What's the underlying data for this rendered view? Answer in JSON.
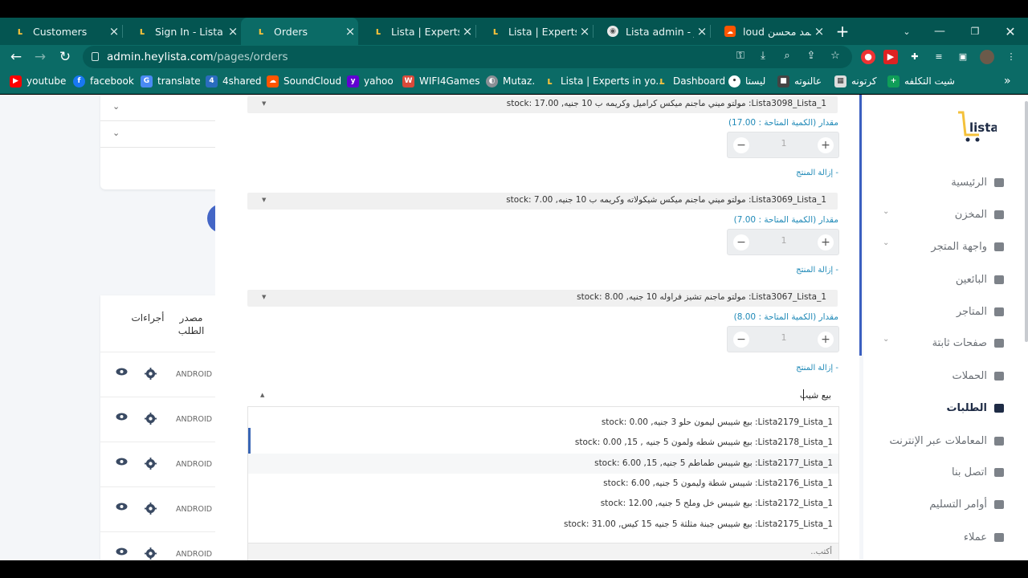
{
  "browser": {
    "tabs": [
      {
        "title": "Customers",
        "icon": "lista-favicon"
      },
      {
        "title": "Sign In - Lista",
        "icon": "lista-favicon"
      },
      {
        "title": "Orders",
        "icon": "lista-favicon",
        "active": true
      },
      {
        "title": "Lista | Experts in y",
        "icon": "lista-favicon"
      },
      {
        "title": "Lista | Experts in y",
        "icon": "lista-favicon"
      },
      {
        "title": "Lista admin - رردر",
        "icon": "globe-icon"
      },
      {
        "title": "loud محمد محسن",
        "icon": "soundcloud-icon"
      }
    ],
    "url_host": "admin.heylista.com",
    "url_path": "/pages/orders",
    "bookmarks": [
      {
        "label": "youtube",
        "color": "#ff0000"
      },
      {
        "label": "facebook",
        "color": "#1877f2"
      },
      {
        "label": "translate",
        "color": "#4a8af4"
      },
      {
        "label": "4shared",
        "color": "#2a6cbf"
      },
      {
        "label": "SoundCloud",
        "color": "#ff5500"
      },
      {
        "label": "yahoo",
        "color": "#6001d2"
      },
      {
        "label": "WIFI4Games",
        "color": "#d94a3a"
      },
      {
        "label": "Mutaz.",
        "color": "#8a8f95"
      },
      {
        "label": "Lista | Experts in yo...",
        "color": "#f4c13b"
      },
      {
        "label": "Dashboard",
        "color": "#f4c13b"
      },
      {
        "label": "ليستا",
        "color": "#ffffff"
      },
      {
        "label": "عالنوته",
        "color": "#444444"
      },
      {
        "label": "كرتونه",
        "color": "#dddddd"
      },
      {
        "label": "شيت التكلفه",
        "color": "#0f9d58"
      }
    ]
  },
  "left_table": {
    "headers": {
      "source": "مصدر الطلب",
      "actions": "أجراءات"
    },
    "rows": [
      {
        "source": "ANDROID"
      },
      {
        "source": "ANDROID"
      },
      {
        "source": "ANDROID"
      },
      {
        "source": "ANDROID"
      },
      {
        "source": "ANDROID"
      }
    ]
  },
  "order_products": [
    {
      "header": "Lista3098_Lista_1: مولتو ميني ماجنم ميكس كراميل وكريمه ب 10 جنيه, stock: 17.00",
      "qty_label": "مقدار (الكمية المتاحة : 17.00)",
      "qty": "1",
      "remove_label": "- إزالة المنتج"
    },
    {
      "header": "Lista3069_Lista_1: مولتو ميني ماجنم ميكس شيكولاته وكريمه ب 10 جنيه, stock: 7.00",
      "qty_label": "مقدار (الكمية المتاحة : 7.00)",
      "qty": "1",
      "remove_label": "- إزالة المنتج"
    },
    {
      "header": "Lista3067_Lista_1: مولتو ماجنم تشيز فراوله 10 جنيه, stock: 8.00",
      "qty_label": "مقدار (الكمية المتاحة : 8.00)",
      "qty": "1",
      "remove_label": "- إزالة المنتج"
    }
  ],
  "product_search": {
    "value": "بيع شيب",
    "options": [
      "Lista2179_Lista_1: بيع شيبس ليمون حلو 3 جنيه, stock: 0.00",
      "Lista2178_Lista_1: بيع شيبس شطه ولمون 5 جنيه , 15, stock: 0.00",
      "Lista2177_Lista_1: بيع شيبس طماطم 5 جنيه, 15, stock: 6.00",
      "Lista2176_Lista_1: شيبس شطة وليمون 5 جنيه, stock: 6.00",
      "Lista2172_Lista_1: بيع شيبس خل وملح 5 جنيه, stock: 12.00",
      "Lista2175_Lista_1: بيع شيبس جبنة مثلثة 5 جنيه 15 كيس, stock: 31.00"
    ],
    "footer_placeholder": "أكتب.."
  },
  "sidebar": {
    "logo_text": "lista",
    "items": [
      {
        "label": "الرئيسية",
        "icon": "dashboard-icon",
        "chevron": false
      },
      {
        "label": "المخزن",
        "icon": "store-icon",
        "chevron": true
      },
      {
        "label": "واجهة المتجر",
        "icon": "store-icon",
        "chevron": true
      },
      {
        "label": "البائعين",
        "icon": "store-icon",
        "chevron": false
      },
      {
        "label": "المتاجر",
        "icon": "store-icon",
        "chevron": false
      },
      {
        "label": "صفحات ثابتة",
        "icon": "store-icon",
        "chevron": true
      },
      {
        "label": "الحملات",
        "icon": "store-icon",
        "chevron": false
      },
      {
        "label": "الطلبات",
        "icon": "cart-icon",
        "chevron": false,
        "active": true
      },
      {
        "label": "المعاملات عبر الإنترنت",
        "icon": "cart-icon",
        "chevron": false
      },
      {
        "label": "اتصل بنا",
        "icon": "users-icon",
        "chevron": false
      },
      {
        "label": "أوامر التسليم",
        "icon": "cart-icon",
        "chevron": false
      },
      {
        "label": "عملاء",
        "icon": "users-icon",
        "chevron": false
      }
    ]
  },
  "colors": {
    "browser_frame": "#0b6b66",
    "tab_strip": "#045551",
    "link_blue": "#1f89b7",
    "sidebar_active": "#1e2b45",
    "accent_blue": "#3b5fc0"
  }
}
